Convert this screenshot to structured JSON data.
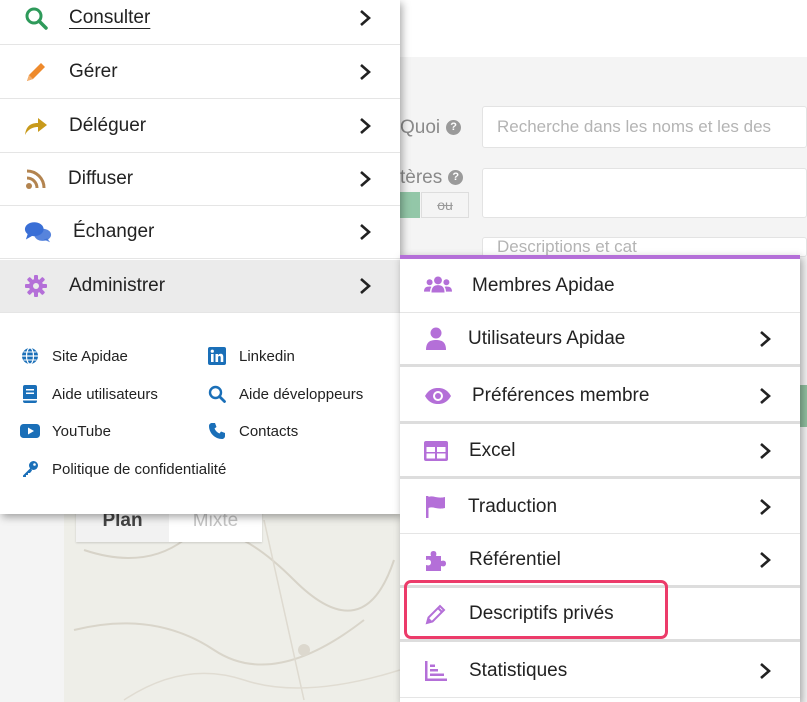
{
  "background": {
    "search_label": "Quoi",
    "search_placeholder": "Recherche dans les noms et les des",
    "criteria_label": "tères",
    "toggle_or": "ou",
    "third_input_text": "Descriptions et cat",
    "map_tabs": [
      "Plan",
      "Mixte"
    ]
  },
  "main_menu": {
    "items": [
      {
        "label": "Consulter",
        "icon": "search-icon"
      },
      {
        "label": "Gérer",
        "icon": "pencil-icon"
      },
      {
        "label": "Déléguer",
        "icon": "share-arrow-icon"
      },
      {
        "label": "Diffuser",
        "icon": "rss-icon"
      },
      {
        "label": "Échanger",
        "icon": "chat-bubbles-icon"
      },
      {
        "label": "Administrer",
        "icon": "gear-icon"
      }
    ],
    "active_item": "Administrer"
  },
  "links": [
    {
      "label": "Site Apidae",
      "icon": "globe-icon"
    },
    {
      "label": "Linkedin",
      "icon": "linkedin-icon"
    },
    {
      "label": "Aide utilisateurs",
      "icon": "book-icon"
    },
    {
      "label": "Aide développeurs",
      "icon": "search-icon"
    },
    {
      "label": "YouTube",
      "icon": "youtube-icon"
    },
    {
      "label": "Contacts",
      "icon": "phone-icon"
    },
    {
      "label": "Politique de confidentialité",
      "icon": "key-icon"
    }
  ],
  "sub_menu": {
    "items": [
      {
        "label": "Membres Apidae",
        "icon": "users-icon",
        "has_chevron": false
      },
      {
        "label": "Utilisateurs Apidae",
        "icon": "user-icon",
        "has_chevron": true
      },
      {
        "label": "Préférences membre",
        "icon": "eye-icon",
        "has_chevron": true
      },
      {
        "label": "Excel",
        "icon": "table-icon",
        "has_chevron": true
      },
      {
        "label": "Traduction",
        "icon": "flag-icon",
        "has_chevron": true
      },
      {
        "label": "Référentiel",
        "icon": "puzzle-icon",
        "has_chevron": true
      },
      {
        "label": "Descriptifs privés",
        "icon": "pencil-icon",
        "has_chevron": false
      },
      {
        "label": "Statistiques",
        "icon": "bar-chart-icon",
        "has_chevron": true
      }
    ],
    "highlighted_item": "Descriptifs privés"
  },
  "colors": {
    "accent_purple": "#b46fd8",
    "highlight_pink": "#ec3b6a",
    "search_green": "#2e9a5a",
    "pencil_orange": "#ee8a2c",
    "share_gold": "#c89a1b",
    "rss_brown": "#b3844f",
    "chat_blue": "#3a6fd6",
    "link_blue": "#1a6fb8"
  }
}
